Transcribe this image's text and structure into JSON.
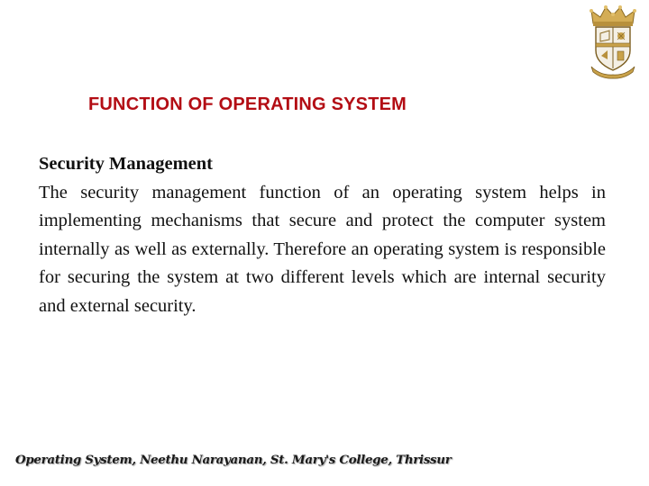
{
  "slide": {
    "title": "FUNCTION OF OPERATING SYSTEM",
    "section_heading": "Security Management",
    "body": "The security management function of an operating system helps in implementing mechanisms that secure and protect the computer system internally as well as externally. Therefore an operating system is responsible for securing the system at two different levels which are internal security and external security.",
    "footer": "Operating System, Neethu Narayanan, St. Mary's College, Thrissur"
  },
  "logo": {
    "icon": "college-crest-icon",
    "colors": {
      "gold": "#c9a24a",
      "dark_gold": "#8a6a22",
      "shield": "#f4efe4",
      "outline": "#7a5c1e"
    }
  },
  "colors": {
    "title": "#b30d14",
    "text": "#111111",
    "background": "#ffffff"
  }
}
